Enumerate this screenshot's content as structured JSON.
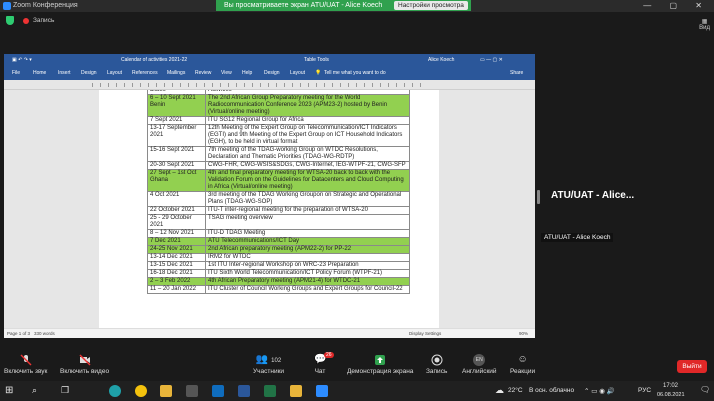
{
  "zoom": {
    "window_title": "Zoom Конференция",
    "share_banner": "Вы просматриваете экран ATU/UAT - Alice Koech",
    "view_options": "Настройки просмотра",
    "recording_label": "Запись",
    "view_button": "Вид",
    "speaker_name": "ATU/UAT - Alice...",
    "speaker_tag": "ATU/UAT - Alice Koech",
    "toolbar": {
      "mute": "Включить звук",
      "video": "Включить видео",
      "participants": "Участники",
      "participants_count": "102",
      "chat": "Чат",
      "chat_badge": "26",
      "share": "Демонстрация экрана",
      "record": "Запись",
      "language": "Английский",
      "language_code": "EN",
      "reactions": "Реакции",
      "leave": "Выйти"
    }
  },
  "word": {
    "doc_title": "Calendar of activities 2021-22",
    "table_tools": "Table Tools",
    "user": "Alice Koech",
    "tabs": [
      "File",
      "Home",
      "Insert",
      "Design",
      "Layout",
      "References",
      "Mailings",
      "Review",
      "View",
      "Help",
      "Design",
      "Layout"
    ],
    "tell_me": "Tell me what you want to do",
    "share": "Share",
    "status_page": "Page 1 of 3",
    "status_words": "330 words",
    "display_settings": "Display Settings",
    "zoom_level": "90%"
  },
  "calendar_rows": [
    {
      "date": "Dates",
      "event": "Activities",
      "highlight": false
    },
    {
      "date": "6 – 10 Sept 2021 Benin",
      "event": "The 2nd African Group Preparatory meeting for the World Radiocommunication Conference 2023 (APM23-2) hosted by Benin (Virtual/online meeting)",
      "highlight": true
    },
    {
      "date": "7 Sept 2021",
      "event": "ITU SG12 Regional Group for Africa",
      "highlight": false
    },
    {
      "date": "13-17 September 2021",
      "event": "12th Meeting of the Expert Group on Telecommunication/ICT Indicators (EGTI) and 9th Meeting of the Expert Group on ICT Household Indicators (EGH), to be held in virtual format",
      "highlight": false
    },
    {
      "date": "15-16 Sept 2021",
      "event": "7th meeting of the TDAG-working Group on WTDC Resolutions, Declaration and Thematic Priorities (TDAG-WG-RDTP)",
      "highlight": false
    },
    {
      "date": "20-30 Sept 2021",
      "event": "CWG-FHR, CWG-WSIS&SDGs, CWG-Internet, IEG-WTPF-21, CWG-SFP",
      "highlight": false
    },
    {
      "date": "27 Sept – 1st Oct Ghana",
      "event": "4th and final preparatory meeting for WTSA-20 back to back with the Validation Forum on the Guidelines for Datacenters and Cloud Computing in Africa (Virtual/online meeting)",
      "highlight": true
    },
    {
      "date": "4 Oct 2021",
      "event": "3rd meeting of the TDAG Working Groupon on Strategic and Operational Plans (TDAG-WG-SOP)",
      "highlight": false
    },
    {
      "date": "22 October 2021",
      "event": "ITU-T inter-regional meeting for the preparation of WTSA-20",
      "highlight": false
    },
    {
      "date": "25 - 29 October 2021",
      "event": "TSAG meeting overview",
      "highlight": false
    },
    {
      "date": "8 – 12 Nov 2021",
      "event": "ITU-D TDAG Meeting",
      "highlight": false
    },
    {
      "date": "7 Dec 2021",
      "event": "ATU Telecommunications/ICT Day",
      "highlight": true
    },
    {
      "date": "24-25 Nov 2021",
      "event": "2nd African preparatory meeting (APM22-2) for PP-22",
      "highlight": true
    },
    {
      "date": "13-14 Dec 2021",
      "event": "IRM2 for WTDC",
      "highlight": false
    },
    {
      "date": "13-15 Dec 2021",
      "event": "1st ITU Inter-regional Workshop on WRC-23 Preparation",
      "highlight": false
    },
    {
      "date": "16-18 Dec 2021",
      "event": "ITU Sixth World Telecommunication/ICT Policy Forum (WTPF-21)",
      "highlight": false
    },
    {
      "date": "2 – 3 Feb 2022",
      "event": "4th African Preparatory meeting (APM21-4) for WTDC-21",
      "highlight": true
    },
    {
      "date": "11 – 20 Jan 2022",
      "event": "ITU Cluster of Council Working Groups and Expert Groups for Council-22",
      "highlight": false
    }
  ],
  "taskbar": {
    "temperature": "22°C",
    "weather": "В осн. облачно",
    "lang": "РУС",
    "time": "17:02",
    "date": "06.08.2021"
  },
  "colors": {
    "zoom_green": "#30a14e",
    "word_blue": "#2b579a",
    "highlight_green": "#92d050",
    "leave_red": "#e02828"
  }
}
